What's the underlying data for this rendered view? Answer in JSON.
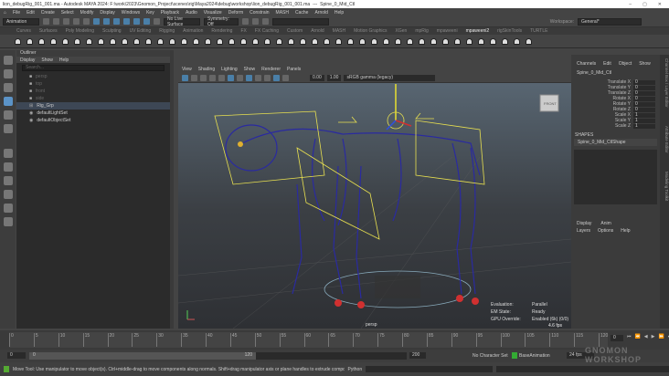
{
  "title": {
    "file": "lion_debugRig_001_001.ma - Autodesk MAYA 2024: F:\\work\\2023\\Gnomon_Project\\scenes\\rig\\Maya2024\\debug\\workshop\\lion_debugRig_001_001.ma",
    "separator": "---",
    "selected": "Spine_0_Mid_Ctl"
  },
  "menu": [
    "File",
    "Edit",
    "Create",
    "Select",
    "Modify",
    "Display",
    "Windows",
    "Key",
    "Playback",
    "Audio",
    "Visualize",
    "Deform",
    "Constrain",
    "MASH",
    "Cache",
    "Arnold",
    "Help"
  ],
  "status": {
    "menuset": "Animation",
    "live_surface": "No Live Surface",
    "symmetry": "Symmetry: Off",
    "workspace_label": "Workspace:",
    "workspace": "General*"
  },
  "shelf_tabs": [
    "Curves",
    "Surfaces",
    "Poly Modeling",
    "Sculpting",
    "UV Editing",
    "Rigging",
    "Animation",
    "Rendering",
    "FX",
    "FX Caching",
    "Custom",
    "Arnold",
    "MASH",
    "Motion Graphics",
    "XGen",
    "mpRig",
    "mpaweeni",
    "mpaweeni2",
    "rigSkinTools",
    "TURTLE"
  ],
  "shelf_active": "mpaweeni2",
  "outliner": {
    "title": "Outliner",
    "menu": [
      "Display",
      "Show",
      "Help"
    ],
    "search_placeholder": "Search...",
    "items": [
      {
        "label": "persp",
        "dim": true
      },
      {
        "label": "top",
        "dim": true
      },
      {
        "label": "front",
        "dim": true
      },
      {
        "label": "side",
        "dim": true
      },
      {
        "label": "Rig_Grp",
        "selected": true
      },
      {
        "label": "defaultLightSet"
      },
      {
        "label": "defaultObjectSet"
      }
    ]
  },
  "viewport": {
    "menu": [
      "View",
      "Shading",
      "Lighting",
      "Show",
      "Renderer",
      "Panels"
    ],
    "exposure": "0.00",
    "gamma": "1.00",
    "colorspace": "sRGB gamma (legacy)",
    "camera": "persp",
    "hud": [
      {
        "k": "Evaluation:",
        "v": "Parallel"
      },
      {
        "k": "EM State:",
        "v": "Ready"
      },
      {
        "k": "GPU Override:",
        "v": "Enabled (6k) (0/0)"
      }
    ],
    "fps": "4.6 fps"
  },
  "channel_box": {
    "menu": [
      "Channels",
      "Edit",
      "Object",
      "Show"
    ],
    "object": "Spine_0_Mid_Ctl",
    "attrs": [
      {
        "l": "Translate X",
        "v": "0"
      },
      {
        "l": "Translate Y",
        "v": "0"
      },
      {
        "l": "Translate Z",
        "v": "0"
      },
      {
        "l": "Rotate X",
        "v": "0"
      },
      {
        "l": "Rotate Y",
        "v": "0"
      },
      {
        "l": "Rotate Z",
        "v": "0"
      },
      {
        "l": "Scale X",
        "v": "1"
      },
      {
        "l": "Scale Y",
        "v": "1"
      },
      {
        "l": "Scale Z",
        "v": "1"
      }
    ],
    "shapes_label": "SHAPES",
    "shape": "Spine_0_Mid_CtlShape",
    "layer_tabs": [
      "Display",
      "Anim"
    ],
    "layer_menu": [
      "Layers",
      "Options",
      "Help"
    ]
  },
  "side_tabs": [
    "Channel Box / Layer Editor",
    "Attribute Editor",
    "Modeling Toolkit"
  ],
  "time": {
    "ticks": [
      "0",
      "5",
      "10",
      "15",
      "20",
      "25",
      "30",
      "35",
      "40",
      "45",
      "50",
      "55",
      "60",
      "65",
      "70",
      "75",
      "80",
      "85",
      "90",
      "95",
      "100",
      "105",
      "110",
      "115",
      "120"
    ],
    "current": "0",
    "start": "0",
    "range_start": "0",
    "range_end": "120",
    "end": "200",
    "character_set": "No Character Set",
    "anim_layer": "BaseAnimation",
    "fps": "24 fps"
  },
  "help": {
    "text": "Move Tool: Use manipulator to move object(s). Ctrl+middle-drag to move components along normals. Shift+drag manipulator axis or plane handles to extrude components or clone objects. Ctrl+Shift+drag to cons",
    "cmd_lang": "Python"
  },
  "watermark": "GNOMON WORKSHOP"
}
